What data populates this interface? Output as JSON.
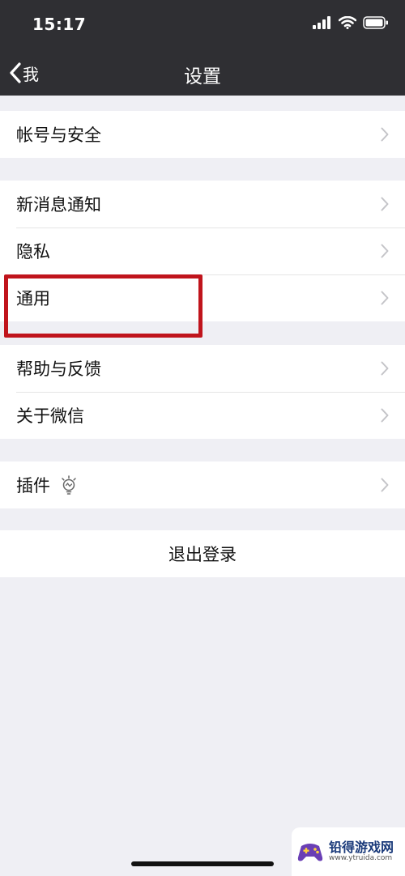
{
  "status_bar": {
    "time": "15:17",
    "icons": [
      "signal-icon",
      "wifi-icon",
      "battery-icon"
    ]
  },
  "nav": {
    "back_label": "我",
    "title": "设置"
  },
  "groups": [
    {
      "items": [
        {
          "label": "帐号与安全"
        }
      ]
    },
    {
      "items": [
        {
          "label": "新消息通知"
        },
        {
          "label": "隐私"
        },
        {
          "label": "通用"
        }
      ]
    },
    {
      "items": [
        {
          "label": "帮助与反馈"
        },
        {
          "label": "关于微信"
        }
      ]
    },
    {
      "items": [
        {
          "label": "插件",
          "icon": "lightbulb-icon"
        }
      ]
    }
  ],
  "logout_label": "退出登录",
  "highlight": {
    "target": "通用",
    "color": "#C0141C"
  },
  "colors": {
    "background": "#EFEFF4",
    "nav_bar": "#2F2F33",
    "cell": "#FFFFFF"
  },
  "watermark": {
    "name": "铅得游戏网",
    "url": "www.ytruida.com"
  }
}
